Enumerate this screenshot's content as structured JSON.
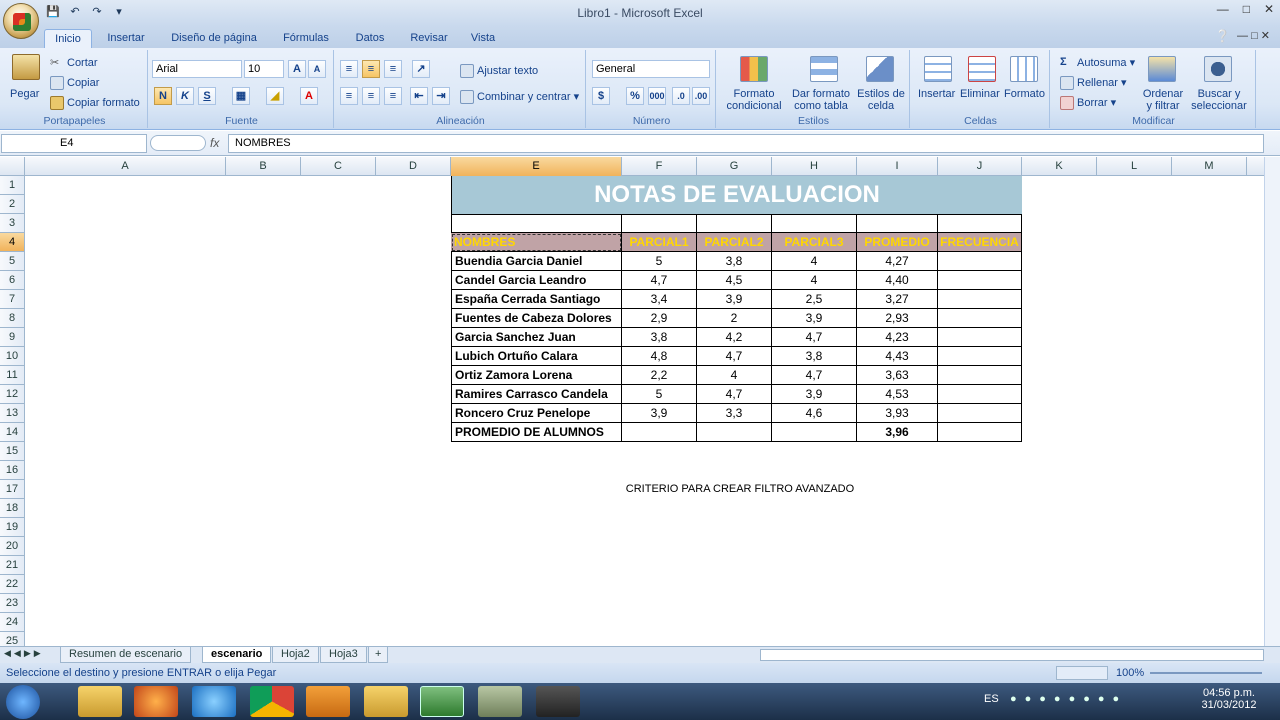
{
  "window": {
    "title": "Libro1 - Microsoft Excel"
  },
  "tabs": [
    "Inicio",
    "Insertar",
    "Diseño de página",
    "Fórmulas",
    "Datos",
    "Revisar",
    "Vista"
  ],
  "ribbon": {
    "portapapeles": {
      "label": "Portapapeles",
      "pegar": "Pegar",
      "cortar": "Cortar",
      "copiar": "Copiar",
      "copiar_formato": "Copiar formato"
    },
    "fuente": {
      "label": "Fuente",
      "font": "Arial",
      "size": "10",
      "bold": "N",
      "italic": "K",
      "underline": "S"
    },
    "alineacion": {
      "label": "Alineación",
      "ajustar": "Ajustar texto",
      "combinar": "Combinar y centrar"
    },
    "numero": {
      "label": "Número",
      "format": "General",
      "currency": "$",
      "percent": "%",
      "thousands": "000"
    },
    "estilos": {
      "label": "Estilos",
      "formato_cond_1": "Formato",
      "formato_cond_2": "condicional",
      "dar_formato_1": "Dar formato",
      "dar_formato_2": "como tabla",
      "estilos_celda_1": "Estilos de",
      "estilos_celda_2": "celda"
    },
    "celdas": {
      "label": "Celdas",
      "insertar": "Insertar",
      "eliminar": "Eliminar",
      "formato": "Formato"
    },
    "modificar": {
      "label": "Modificar",
      "autosuma": "Autosuma",
      "rellenar": "Rellenar",
      "borrar": "Borrar",
      "ordenar_1": "Ordenar",
      "ordenar_2": "y filtrar",
      "buscar_1": "Buscar y",
      "buscar_2": "seleccionar"
    }
  },
  "formula_bar": {
    "name_box": "E4",
    "fx": "fx",
    "value": "NOMBRES"
  },
  "columns": [
    "A",
    "B",
    "C",
    "D",
    "E",
    "F",
    "G",
    "H",
    "I",
    "J",
    "K",
    "L",
    "M"
  ],
  "rows": [
    "1",
    "2",
    "3",
    "4",
    "5",
    "6",
    "7",
    "8",
    "9",
    "10",
    "11",
    "12",
    "13",
    "14",
    "15",
    "16",
    "17",
    "18",
    "19",
    "20",
    "21",
    "22",
    "23",
    "24",
    "25"
  ],
  "sheet": {
    "title": "NOTAS DE EVALUACION",
    "headers": [
      "NOMBRES",
      "PARCIAL1",
      "PARCIAL2",
      "PARCIAL3",
      "PROMEDIO",
      "FRECUENCIA"
    ],
    "data": [
      [
        "Buendia Garcia Daniel",
        "5",
        "3,8",
        "4",
        "4,27",
        ""
      ],
      [
        "Candel Garcia Leandro",
        "4,7",
        "4,5",
        "4",
        "4,40",
        ""
      ],
      [
        "España Cerrada Santiago",
        "3,4",
        "3,9",
        "2,5",
        "3,27",
        ""
      ],
      [
        "Fuentes de Cabeza Dolores",
        "2,9",
        "2",
        "3,9",
        "2,93",
        ""
      ],
      [
        "Garcia Sanchez Juan",
        "3,8",
        "4,2",
        "4,7",
        "4,23",
        ""
      ],
      [
        "Lubich Ortuño Calara",
        "4,8",
        "4,7",
        "3,8",
        "4,43",
        ""
      ],
      [
        "Ortiz Zamora Lorena",
        "2,2",
        "4",
        "4,7",
        "3,63",
        ""
      ],
      [
        "Ramires Carrasco Candela",
        "5",
        "4,7",
        "3,9",
        "4,53",
        ""
      ],
      [
        "Roncero Cruz Penelope",
        "3,9",
        "3,3",
        "4,6",
        "3,93",
        ""
      ]
    ],
    "footer_label": "PROMEDIO DE ALUMNOS",
    "footer_value": "3,96",
    "criterio": "CRITERIO PARA CREAR FILTRO AVANZADO"
  },
  "sheet_tabs": [
    "Resumen de escenario",
    "escenario",
    "Hoja2",
    "Hoja3"
  ],
  "status": {
    "message": "Seleccione el destino y presione ENTRAR o elija Pegar",
    "zoom": "100%"
  },
  "taskbar": {
    "lang": "ES",
    "time": "04:56 p.m.",
    "date": "31/03/2012"
  },
  "colors": {
    "title_bg": "#a7c8d6",
    "header_bg": "#c0a3a6",
    "header_text": "#ffd700"
  }
}
